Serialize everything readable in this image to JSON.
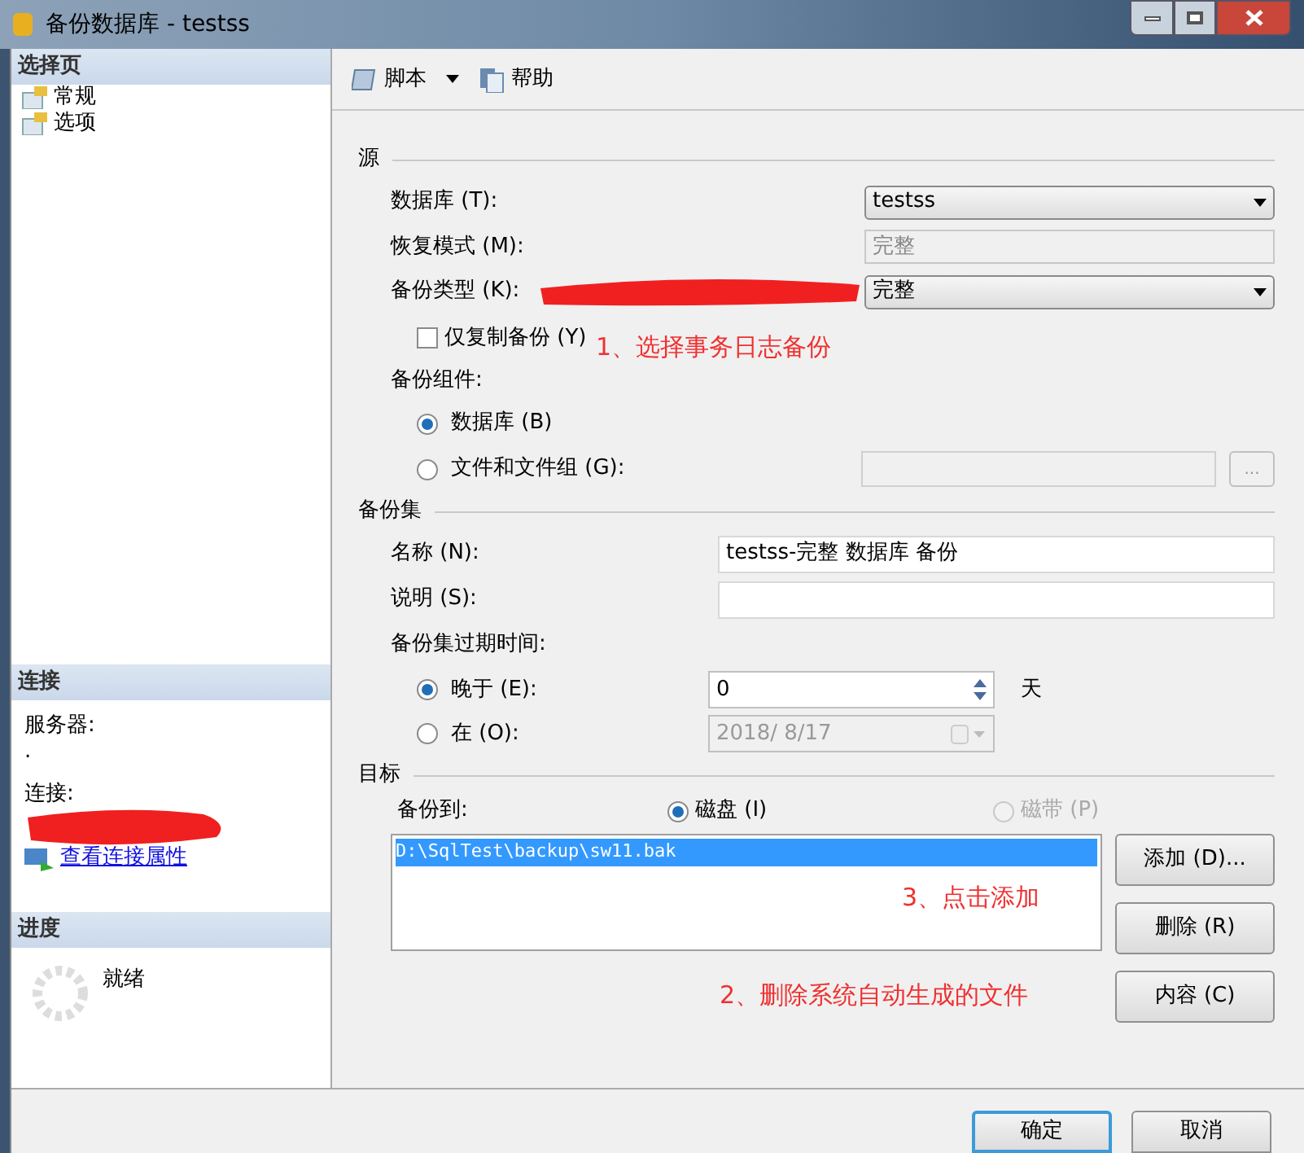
{
  "window": {
    "title": "备份数据库 - testss"
  },
  "sidebar": {
    "header": "选择页",
    "items": [
      {
        "label": "常规",
        "selected": false
      },
      {
        "label": "选项",
        "selected": false
      }
    ]
  },
  "connection": {
    "header": "连接",
    "server_label": "服务器:",
    "server_value": ".",
    "connection_label": "连接:",
    "link": "查看连接属性"
  },
  "progress": {
    "header": "进度",
    "status": "就绪"
  },
  "toolbar": [
    {
      "label": "脚本",
      "kind": "dropdown"
    },
    {
      "label": "帮助",
      "kind": "button"
    }
  ],
  "source": {
    "title": "源",
    "database_label": "数据库 (T):",
    "database_value": "testss",
    "recovery_label": "恢复模式 (M):",
    "recovery_value": "完整",
    "type_label": "备份类型 (K):",
    "type_value": "完整",
    "copy_only": {
      "label": "仅复制备份 (Y)",
      "checked": false
    },
    "component_label": "备份组件:",
    "components": [
      {
        "label": "数据库 (B)",
        "selected": true
      },
      {
        "label": "文件和文件组 (G):",
        "selected": false
      }
    ],
    "browse": "..."
  },
  "backup_set": {
    "title": "备份集",
    "name_label": "名称 (N):",
    "name_value": "testss-完整 数据库 备份",
    "desc_label": "说明 (S):",
    "expire_label": "备份集过期时间:",
    "expire_options": [
      {
        "label": "晚于 (E):",
        "selected": true,
        "value": "0",
        "unit": "天"
      },
      {
        "label": "在 (O):",
        "selected": false,
        "value": "2018/ 8/17"
      }
    ]
  },
  "destination": {
    "title": "目标",
    "to_label": "备份到:",
    "media": [
      {
        "label": "磁盘 (I)",
        "selected": true,
        "disabled": false
      },
      {
        "label": "磁带 (P)",
        "selected": false,
        "disabled": true
      }
    ],
    "files": [
      {
        "path": "D:\\SqlTest\\backup\\sw11.bak",
        "selected": true
      }
    ],
    "buttons": [
      "添加 (D)...",
      "删除 (R)",
      "内容 (C)"
    ]
  },
  "annotations": [
    "1、选择事务日志备份",
    "3、点击添加",
    "2、删除系统自动生成的文件"
  ],
  "footer_buttons": [
    {
      "label": "确定",
      "selected": true
    },
    {
      "label": "取消",
      "selected": false
    }
  ]
}
